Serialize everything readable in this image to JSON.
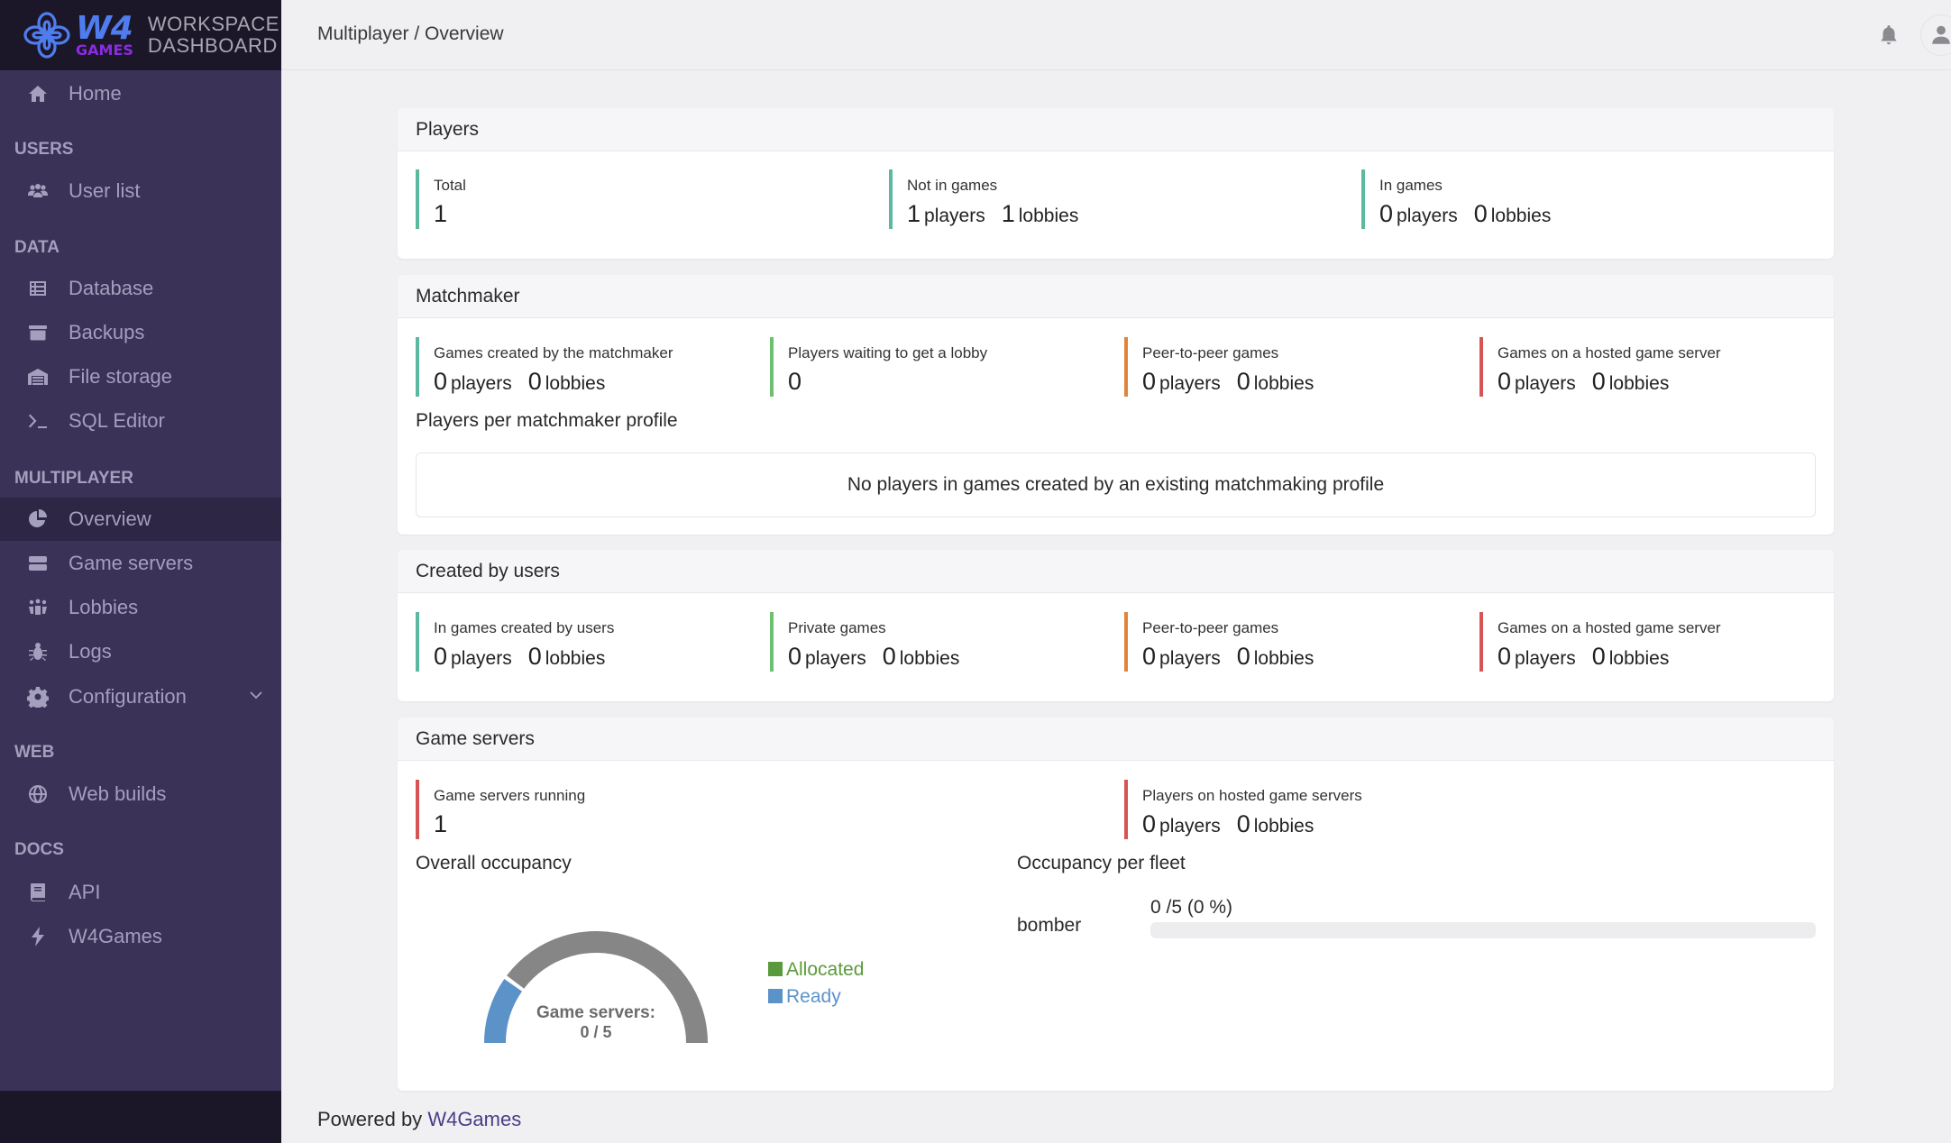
{
  "brand": {
    "logo_main": "W4",
    "logo_sub": "GAMES",
    "title_line1": "WORKSPACE",
    "title_line2": "DASHBOARD"
  },
  "sidebar": {
    "home": "Home",
    "sections": [
      {
        "title": "USERS",
        "items": [
          {
            "label": "User list",
            "icon": "users-icon"
          }
        ]
      },
      {
        "title": "DATA",
        "items": [
          {
            "label": "Database",
            "icon": "table-icon"
          },
          {
            "label": "Backups",
            "icon": "archive-icon"
          },
          {
            "label": "File storage",
            "icon": "warehouse-icon"
          },
          {
            "label": "SQL Editor",
            "icon": "terminal-icon"
          }
        ]
      },
      {
        "title": "MULTIPLAYER",
        "items": [
          {
            "label": "Overview",
            "icon": "pie-chart-icon",
            "active": true
          },
          {
            "label": "Game servers",
            "icon": "server-icon"
          },
          {
            "label": "Lobbies",
            "icon": "people-group-icon"
          },
          {
            "label": "Logs",
            "icon": "bug-icon"
          },
          {
            "label": "Configuration",
            "icon": "gear-icon",
            "expandable": true
          }
        ]
      },
      {
        "title": "WEB",
        "items": [
          {
            "label": "Web builds",
            "icon": "globe-icon"
          }
        ]
      },
      {
        "title": "DOCS",
        "items": [
          {
            "label": "API",
            "icon": "book-icon"
          },
          {
            "label": "W4Games",
            "icon": "bolt-icon"
          }
        ]
      }
    ]
  },
  "topbar": {
    "breadcrumb": "Multiplayer / Overview",
    "icons": [
      "bell-icon",
      "user-icon"
    ]
  },
  "units": {
    "players": "players",
    "lobbies": "lobbies"
  },
  "players_card": {
    "title": "Players",
    "total": {
      "label": "Total",
      "value": "1"
    },
    "not_in_games": {
      "label": "Not in games",
      "players": "1",
      "lobbies": "1"
    },
    "in_games": {
      "label": "In games",
      "players": "0",
      "lobbies": "0"
    }
  },
  "matchmaker_card": {
    "title": "Matchmaker",
    "created_by_matchmaker": {
      "label": "Games created by the matchmaker",
      "players": "0",
      "lobbies": "0"
    },
    "waiting": {
      "label": "Players waiting to get a lobby",
      "value": "0"
    },
    "p2p": {
      "label": "Peer-to-peer games",
      "players": "0",
      "lobbies": "0"
    },
    "hosted": {
      "label": "Games on a hosted game server",
      "players": "0",
      "lobbies": "0"
    },
    "per_profile_title": "Players per matchmaker profile",
    "per_profile_empty": "No players in games created by an existing matchmaking profile"
  },
  "users_card": {
    "title": "Created by users",
    "in_games": {
      "label": "In games created by users",
      "players": "0",
      "lobbies": "0"
    },
    "private": {
      "label": "Private games",
      "players": "0",
      "lobbies": "0"
    },
    "p2p": {
      "label": "Peer-to-peer games",
      "players": "0",
      "lobbies": "0"
    },
    "hosted": {
      "label": "Games on a hosted game server",
      "players": "0",
      "lobbies": "0"
    }
  },
  "servers_card": {
    "title": "Game servers",
    "running": {
      "label": "Game servers running",
      "value": "1"
    },
    "hosted_players": {
      "label": "Players on hosted game servers",
      "players": "0",
      "lobbies": "0"
    },
    "overall_title": "Overall occupancy",
    "fleet_title": "Occupancy per fleet",
    "gauge": {
      "center_label": "Game servers:",
      "center_value": "0 / 5",
      "allocated": 0,
      "ready": 1,
      "capacity": 5,
      "colors": {
        "allocated": "#5b9a3c",
        "ready": "#5b93c9",
        "empty": "#868686"
      }
    },
    "legend": [
      {
        "label": "Allocated",
        "color": "#5b9a3c"
      },
      {
        "label": "Ready",
        "color": "#5b93c9"
      }
    ],
    "fleets": [
      {
        "name": "bomber",
        "text": "0 /5 (0 %)",
        "used": 0,
        "capacity": 5,
        "percent": 0
      }
    ]
  },
  "footer": {
    "prefix": "Powered by",
    "link": "W4Games"
  }
}
